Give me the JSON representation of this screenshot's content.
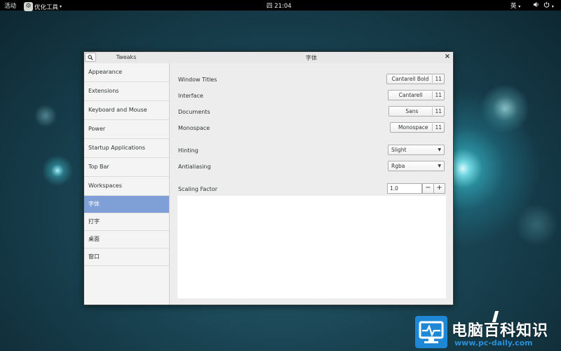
{
  "topbar": {
    "activities": "活动",
    "app_name": "优化工具",
    "app_icon": "tweaks-app-icon",
    "clock": "四 21:04",
    "language": "英",
    "volume_icon": "volume-icon",
    "power_icon": "power-icon"
  },
  "window": {
    "app_title": "Tweaks",
    "page_title": "字体",
    "search_icon": "search-icon",
    "close_icon": "close-icon"
  },
  "sidebar": {
    "items": [
      {
        "label": "Appearance",
        "active": false
      },
      {
        "label": "Extensions",
        "active": false
      },
      {
        "label": "Keyboard and Mouse",
        "active": false
      },
      {
        "label": "Power",
        "active": false
      },
      {
        "label": "Startup Applications",
        "active": false
      },
      {
        "label": "Top Bar",
        "active": false
      },
      {
        "label": "Workspaces",
        "active": false
      },
      {
        "label": "字体",
        "active": true
      },
      {
        "label": "打字",
        "active": false
      },
      {
        "label": "桌面",
        "active": false
      },
      {
        "label": "窗口",
        "active": false
      }
    ]
  },
  "fonts": {
    "window_titles": {
      "label": "Window Titles",
      "font": "Cantarell Bold",
      "size": "11"
    },
    "interface": {
      "label": "Interface",
      "font": "Cantarell",
      "size": "11"
    },
    "documents": {
      "label": "Documents",
      "font": "Sans",
      "size": "11"
    },
    "monospace": {
      "label": "Monospace",
      "font": "Monospace",
      "size": "11"
    }
  },
  "rendering": {
    "hinting": {
      "label": "Hinting",
      "value": "Slight"
    },
    "antialiasing": {
      "label": "Antialiasing",
      "value": "Rgba"
    }
  },
  "scaling": {
    "label": "Scaling Factor",
    "value": "1.0",
    "minus": "−",
    "plus": "+"
  },
  "watermark": {
    "text": "电脑百科知识",
    "url": "www.pc-daily.com"
  },
  "colors": {
    "selection": "#7f9fd7",
    "topbar": "#000000",
    "watermark_blue": "#1e88d6"
  }
}
